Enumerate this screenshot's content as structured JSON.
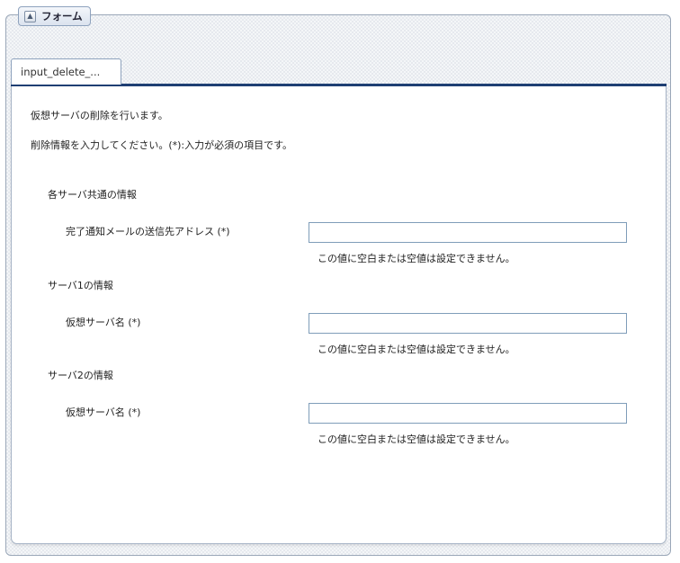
{
  "fieldset": {
    "legend": "フォーム",
    "legend_icon": "collapse-up-icon"
  },
  "tab": {
    "label": "input_delete_..."
  },
  "intro": {
    "line1": "仮想サーバの削除を行います。",
    "line2": "削除情報を入力してください。(*):入力が必須の項目です。"
  },
  "sections": [
    {
      "title": "各サーバ共通の情報",
      "field_label": "完了通知メールの送信先アドレス (*)",
      "value": "",
      "error": "この値に空白または空値は設定できません。"
    },
    {
      "title": "サーバ1の情報",
      "field_label": "仮想サーバ名 (*)",
      "value": "",
      "error": "この値に空白または空値は設定できません。"
    },
    {
      "title": "サーバ2の情報",
      "field_label": "仮想サーバ名 (*)",
      "value": "",
      "error": "この値に空白または空値は設定できません。"
    }
  ]
}
